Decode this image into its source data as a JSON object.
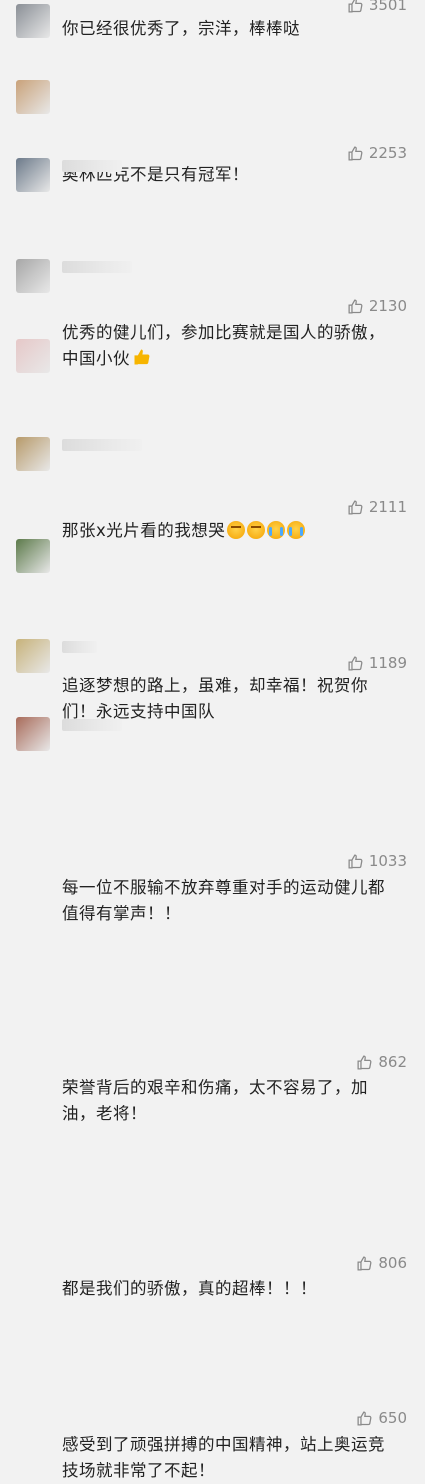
{
  "comments": [
    {
      "likes": "3501",
      "text": "你已经很优秀了，宗洋，棒棒哒",
      "avatar_color": "#8a8f96"
    },
    {
      "likes": "2253",
      "text": "奥林匹克不是只有冠军！",
      "avatar_color": "#c9a27a"
    },
    {
      "likes": "2130",
      "text": "优秀的健儿们，参加比赛就是国人的骄傲，\n中国小伙",
      "avatar_color": "#6c7a8a"
    },
    {
      "likes": "2111",
      "text": "那张x光片看的我想哭",
      "avatar_color": "#a7a7a7"
    },
    {
      "likes": "1189",
      "text": "追逐梦想的路上，虽难，却幸福！祝贺你\n们！永远支持中国队",
      "avatar_color": "#e6c8c8"
    },
    {
      "likes": "1033",
      "text": "每一位不服输不放弃尊重对手的运动健儿都\n值得有掌声！！",
      "avatar_color": "#b79a6a"
    },
    {
      "likes": "862",
      "text": "荣誉背后的艰辛和伤痛，太不容易了，加\n油，老将！",
      "avatar_color": "#5c7a4a"
    },
    {
      "likes": "806",
      "text": "都是我们的骄傲，真的超棒！！！",
      "avatar_color": "#c7b27a"
    },
    {
      "likes": "650",
      "text": "感受到了顽强拼搏的中国精神，站上奥运竞\n技场就非常了不起！",
      "avatar_color": "#a86b5a"
    }
  ],
  "icons": {
    "like": "thumbs-up-outline-icon"
  }
}
